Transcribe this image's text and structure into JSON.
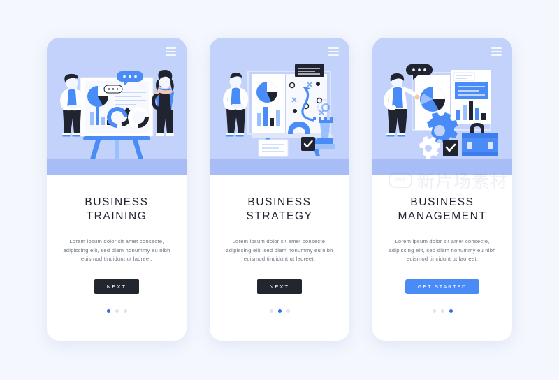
{
  "page": {
    "background_color": "#f4f7fd",
    "watermark": {
      "badge": "new",
      "text": "新片场素材"
    }
  },
  "palette": {
    "hero_bg": "#c3d2fb",
    "hero_floor": "#a8bdf6",
    "accent_blue": "#4a8cf7",
    "dark_button": "#22262f",
    "dot_active": "#2f6fe8",
    "dot_inactive": "#dfe4ef",
    "title_color": "#1f2430",
    "body_color": "#6d7583"
  },
  "cards": [
    {
      "menu_icon": "hamburger-icon",
      "illustration": "business-training-illustration",
      "title": "BUSINESS\nTRAINING",
      "title_line1": "BUSINESS",
      "title_line2": "TRAINING",
      "description": "Lorem ipsum dolor sit amet consecte, adipiscing elit, sed diam nonummy eu nibh euismod tincidunt ut laoreet.",
      "button": {
        "label": "NEXT",
        "style": "dark"
      },
      "dots": {
        "count": 3,
        "active_index": 0
      }
    },
    {
      "menu_icon": "hamburger-icon",
      "illustration": "business-strategy-illustration",
      "title": "BUSINESS\nSTRATEGY",
      "title_line1": "BUSINESS",
      "title_line2": "STRATEGY",
      "description": "Lorem ipsum dolor sit amet consecte, adipiscing elit, sed diam nonummy eu nibh euismod tincidunt ut laoreet.",
      "button": {
        "label": "NEXT",
        "style": "dark"
      },
      "dots": {
        "count": 3,
        "active_index": 1
      }
    },
    {
      "menu_icon": "hamburger-icon",
      "illustration": "business-management-illustration",
      "title": "BUSINESS\nMANAGEMENT",
      "title_line1": "BUSINESS",
      "title_line2": "MANAGEMENT",
      "description": "Lorem ipsum dolor sit amet consecte, adipiscing elit, sed diam nonummy eu nibh euismod tincidunt ut laoreet.",
      "button": {
        "label": "GET STARTED",
        "style": "blue"
      },
      "dots": {
        "count": 3,
        "active_index": 2
      }
    }
  ]
}
